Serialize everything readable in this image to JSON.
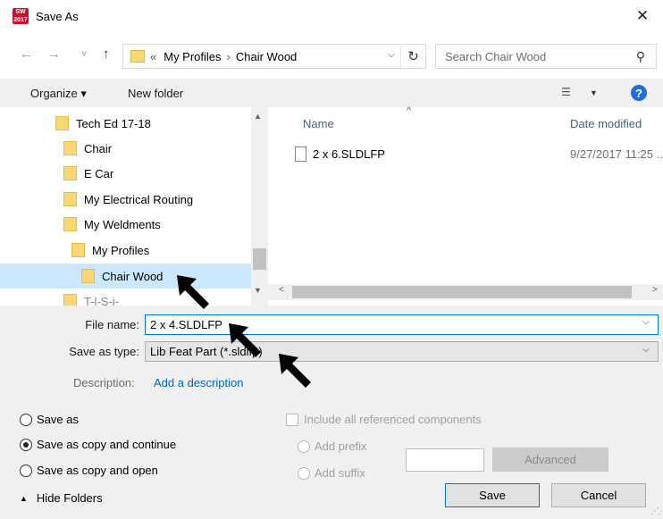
{
  "window": {
    "title": "Save As",
    "app_icon_text": "SW 2017",
    "close_glyph": "✕"
  },
  "nav_buttons": {
    "back": "←",
    "forward": "→",
    "recent": "˅",
    "up": "↑"
  },
  "address": {
    "prefix": "«",
    "crumbs": [
      "My Profiles",
      "Chair Wood"
    ],
    "separator": "›",
    "dropdown": "⌵",
    "refresh": "↻"
  },
  "search": {
    "placeholder": "Search Chair Wood",
    "icon": "⚲"
  },
  "toolbar": {
    "organize": "Organize ▾",
    "new_folder": "New folder",
    "view_glyph": "☰",
    "view_drop": "▼",
    "help": "?"
  },
  "nav_tree": {
    "items": [
      {
        "label": "Tech Ed 17-18",
        "selected": false
      },
      {
        "label": "Chair",
        "selected": false
      },
      {
        "label": "E Car",
        "selected": false
      },
      {
        "label": "My Electrical Routing",
        "selected": false
      },
      {
        "label": "My Weldments",
        "selected": false
      },
      {
        "label": "My Profiles",
        "selected": false
      },
      {
        "label": "Chair Wood",
        "selected": true
      },
      {
        "label": "T-l-S-i-",
        "selected": false
      }
    ]
  },
  "file_list": {
    "columns": {
      "name": "Name",
      "date": "Date modified",
      "sort_glyph": "^"
    },
    "files": [
      {
        "name": "2 x 6.SLDLFP",
        "date": "9/27/2017 11:25 ..."
      }
    ]
  },
  "form": {
    "file_name_label": "File name:",
    "file_name_value": "2 x 4.SLDLFP",
    "save_type_label": "Save as type:",
    "save_type_value": "Lib Feat Part (*.sldlfp)",
    "description_label": "Description:",
    "description_link": "Add a description"
  },
  "options": {
    "save_as": "Save as",
    "save_copy_continue": "Save as copy and continue",
    "save_copy_open": "Save as copy and open",
    "selected": "save_copy_continue",
    "include_refs": "Include all referenced components",
    "add_prefix": "Add prefix",
    "add_suffix": "Add suffix",
    "advanced": "Advanced"
  },
  "footer": {
    "hide_folders": "Hide Folders",
    "save": "Save",
    "cancel": "Cancel"
  },
  "colors": {
    "accent": "#0078d7",
    "selection": "#cce8ff",
    "folder": "#f8d775",
    "link": "#0066cc"
  }
}
